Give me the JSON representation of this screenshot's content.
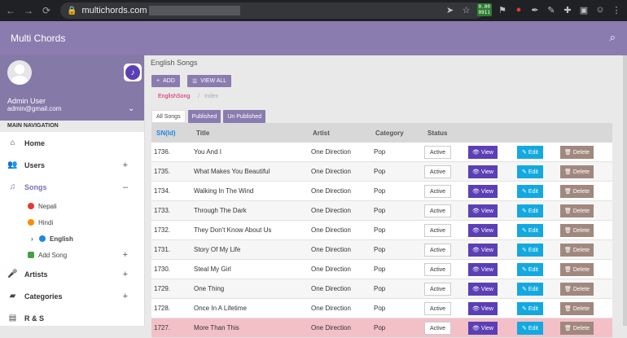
{
  "browser": {
    "url": "multichords.com",
    "icons": [
      "send-icon",
      "star-icon",
      "battery-icon",
      "extension-icon",
      "extension-icon",
      "pen-icon",
      "edit-icon",
      "puzzle-icon",
      "sidebar-icon",
      "profile-icon",
      "menu-icon"
    ],
    "battery_label_top": "0.00",
    "battery_label_bottom": "0911"
  },
  "app": {
    "title": "Multi Chords"
  },
  "profile": {
    "name": "Admin User",
    "email": "admin@gmail.com"
  },
  "nav": {
    "header": "MAIN NAVIGATION",
    "items": [
      {
        "label": "Home"
      },
      {
        "label": "Users",
        "toggle": "+"
      },
      {
        "label": "Songs",
        "toggle": "–"
      },
      {
        "label": "Artists",
        "toggle": "+"
      },
      {
        "label": "Categories",
        "toggle": "+"
      },
      {
        "label": "R & S"
      }
    ],
    "songs_sub": [
      {
        "label": "Nepali",
        "color": "#e53935"
      },
      {
        "label": "Hindi",
        "color": "#fb8c00"
      },
      {
        "label": "English",
        "color": "#1e88e5"
      },
      {
        "label": "Add Song",
        "color": "#43a047",
        "toggle": "+"
      }
    ]
  },
  "content": {
    "heading": "English Songs",
    "add_label": "ADD",
    "view_all_label": "VIEW ALL",
    "crumb_active": "EnglishSong",
    "crumb_sep": "/",
    "crumb_index": "Index",
    "tabs": [
      "All Songs",
      "Published",
      "Un Published"
    ]
  },
  "table": {
    "headers": {
      "sn": "SN(Id)",
      "title": "Title",
      "artist": "Artist",
      "category": "Category",
      "status": "Status"
    },
    "rows": [
      {
        "sn": "1736.",
        "title": "You And I",
        "artist": "One Direction",
        "category": "Pop",
        "status": "Active",
        "view": "View",
        "edit": "Edit",
        "delete": "Delete"
      },
      {
        "sn": "1735.",
        "title": "What Makes You Beautiful",
        "artist": "One Direction",
        "category": "Pop",
        "status": "Active",
        "view": "View",
        "edit": "Edit",
        "delete": "Delete"
      },
      {
        "sn": "1734.",
        "title": "Walking In The Wind",
        "artist": "One Direction",
        "category": "Pop",
        "status": "Active",
        "view": "View",
        "edit": "Edit",
        "delete": "Delete"
      },
      {
        "sn": "1733.",
        "title": "Through The Dark",
        "artist": "One Direction",
        "category": "Pop",
        "status": "Active",
        "view": "View",
        "edit": "Edit",
        "delete": "Delete"
      },
      {
        "sn": "1732.",
        "title": "They Don't Know About Us",
        "artist": "One Direction",
        "category": "Pop",
        "status": "Active",
        "view": "View",
        "edit": "Edit",
        "delete": "Delete"
      },
      {
        "sn": "1731.",
        "title": "Story Of My Life",
        "artist": "One Direction",
        "category": "Pop",
        "status": "Active",
        "view": "View",
        "edit": "Edit",
        "delete": "Delete"
      },
      {
        "sn": "1730.",
        "title": "Steal My Girl",
        "artist": "One Direction",
        "category": "Pop",
        "status": "Active",
        "view": "View",
        "edit": "Edit",
        "delete": "Delete"
      },
      {
        "sn": "1729.",
        "title": "One Thing",
        "artist": "One Direction",
        "category": "Pop",
        "status": "Active",
        "view": "View",
        "edit": "Edit",
        "delete": "Delete"
      },
      {
        "sn": "1728.",
        "title": "Once In A Lifetime",
        "artist": "One Direction",
        "category": "Pop",
        "status": "Active",
        "view": "View",
        "edit": "Edit",
        "delete": "Delete"
      },
      {
        "sn": "1727.",
        "title": "More Than This",
        "artist": "One Direction",
        "category": "Pop",
        "status": "Active",
        "view": "View",
        "edit": "Edit",
        "delete": "Delete"
      }
    ]
  },
  "colors": {
    "brand": "#8b7cb0",
    "view": "#5b3fb5",
    "edit": "#13a9e0",
    "delete": "#a1887f",
    "sn_header": "#1e88e5",
    "crumb_active": "#d81b60"
  }
}
